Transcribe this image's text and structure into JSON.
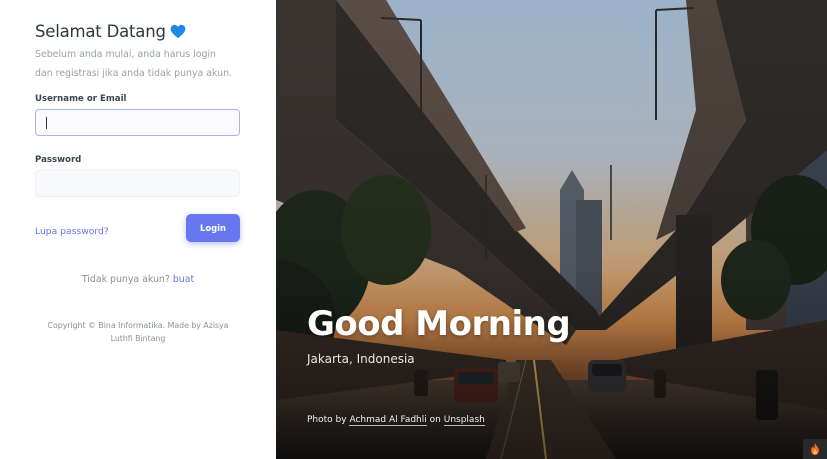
{
  "login": {
    "title": "Selamat Datang",
    "subtitle": "Sebelum anda mulai, anda harus login dan registrasi jika anda tidak punya akun.",
    "username_label": "Username or Email",
    "username_value": "",
    "password_label": "Password",
    "password_value": "",
    "forgot_label": "Lupa password?",
    "login_label": "Login",
    "register_text": "Tidak punya akun?",
    "register_link": "buat",
    "copyright": "Copyright © Bina Informatika. Made by Azisya Luthfi Bintang"
  },
  "hero": {
    "greeting": "Good Morning",
    "location": "Jakarta, Indonesia",
    "credit_prefix": "Photo by",
    "credit_author": "Achmad Al Fadhli",
    "credit_middle": "on",
    "credit_site": "Unsplash"
  },
  "colors": {
    "accent": "#6777ef",
    "heart": "#1e88e5"
  }
}
